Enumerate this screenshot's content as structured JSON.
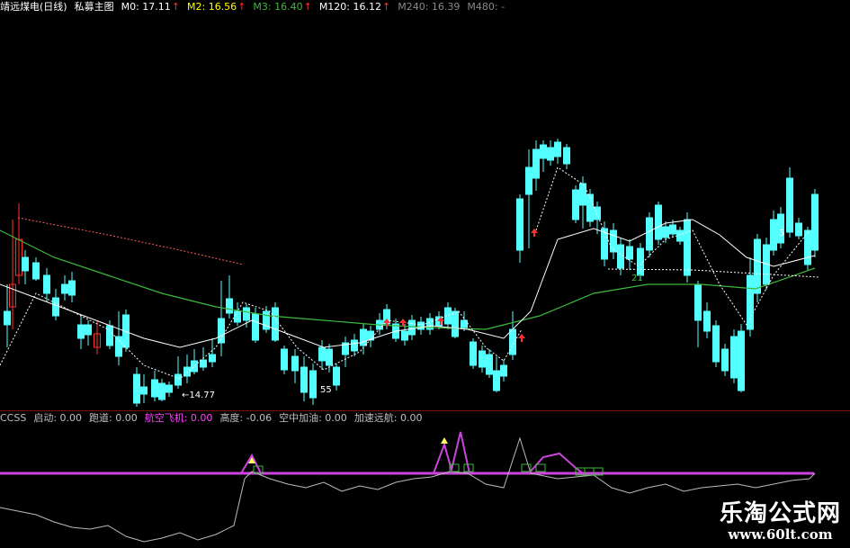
{
  "header": {
    "title": "靖远煤电(日线)",
    "indicator": "私募主图",
    "m0": "M0: 17.11",
    "m2": "M2: 16.56",
    "m3": "M3: 16.40",
    "m120": "M120: 16.12",
    "m240": "M240: 16.39",
    "m480": "M480: -",
    "arrow": "↑",
    "colors": {
      "title": "#ffffff",
      "m0": "#ffffff",
      "m2": "#ffff00",
      "m3": "#ff40ff",
      "m120": "#00ff00",
      "m240": "#888888",
      "m480": "#888888",
      "arrow": "#ff3030"
    }
  },
  "indicator_header": {
    "name": "CCSS",
    "start": "启动: 0.00",
    "run": "跑道: 0.00",
    "takeoff": "航空飞机: 0.00",
    "height": "高度: -0.06",
    "air_refuel": "空中加油: 0.00",
    "accelerate": "加速远航: 0.00",
    "colors": {
      "default": "#c0c0c0",
      "takeoff": "#ff40ff",
      "height_up": "#ff3030"
    }
  },
  "annotations": {
    "low_price": "←14.77",
    "label_55": "55",
    "label_21": "21",
    "label_5": "5"
  },
  "watermark": {
    "text": "乐淘公式网",
    "url": "www.60lt.com"
  },
  "colors": {
    "up": "#ff3030",
    "down": "#54ffff",
    "ma_white": "#ffffff",
    "ma_green": "#3cb83c",
    "ma_dotted": "#ff5a5a",
    "indicator_line": "#bbbbbb",
    "indicator_magenta": "#cc44dd",
    "indicator_green": "#3cb83c"
  }
}
